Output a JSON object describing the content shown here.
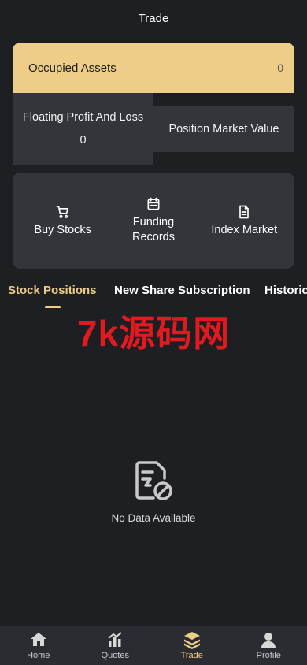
{
  "header": {
    "title": "Trade"
  },
  "assets": {
    "label": "Occupied Assets",
    "value": "0"
  },
  "floating_pl": {
    "label": "Floating Profit And Loss",
    "value": "0"
  },
  "market_value": {
    "label": "Position Market Value"
  },
  "actions": [
    {
      "label": "Buy Stocks",
      "icon": "cart-icon"
    },
    {
      "label": "Funding Records",
      "icon": "calendar-icon"
    },
    {
      "label": "Index Market",
      "icon": "document-icon"
    }
  ],
  "tabs": [
    {
      "label": "Stock Positions",
      "active": true
    },
    {
      "label": "New Share Subscription",
      "active": false
    },
    {
      "label": "Historic",
      "active": false
    }
  ],
  "watermark": "7k源码网",
  "empty_state": {
    "text": "No Data Available",
    "icon": "no-data-icon"
  },
  "bottom_nav": [
    {
      "label": "Home",
      "icon": "home-icon",
      "active": false
    },
    {
      "label": "Quotes",
      "icon": "chart-icon",
      "active": false
    },
    {
      "label": "Trade",
      "icon": "layers-icon",
      "active": true
    },
    {
      "label": "Profile",
      "icon": "user-icon",
      "active": false
    }
  ],
  "colors": {
    "accent": "#edcd88",
    "background": "#1e1f23",
    "card": "#33353b",
    "watermark": "#e01a1f"
  }
}
